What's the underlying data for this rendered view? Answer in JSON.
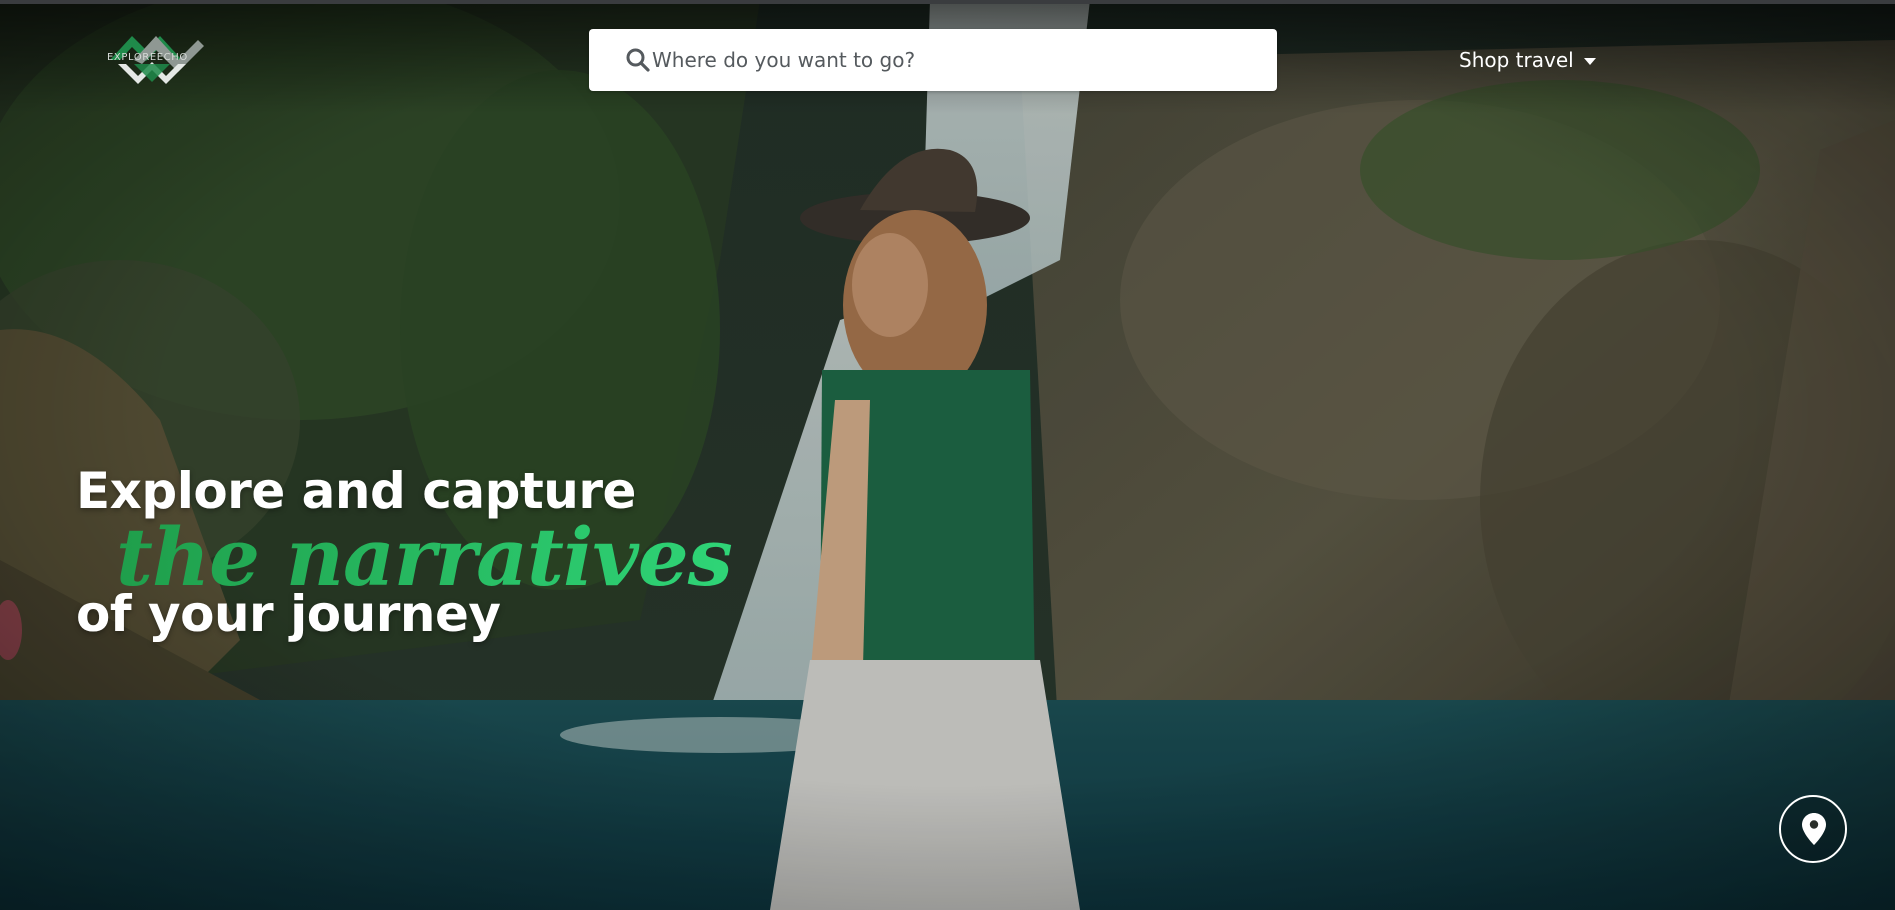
{
  "logo": {
    "text": "EXPLOREECHO",
    "icon": "mountain-chevron-logo",
    "colors": [
      "#1f8a4a",
      "#9aa39e",
      "#ffffff"
    ]
  },
  "search": {
    "placeholder": "Where do you want to go?",
    "value": "",
    "icon": "search-icon"
  },
  "nav": {
    "shop_label": "Shop travel",
    "shop_icon": "caret-down-icon"
  },
  "hero": {
    "line1": "Explore and capture",
    "line2": "the narratives",
    "line3": "of your journey",
    "accent_color": "#2ecf73"
  },
  "location_button": {
    "icon": "map-pin-icon"
  }
}
